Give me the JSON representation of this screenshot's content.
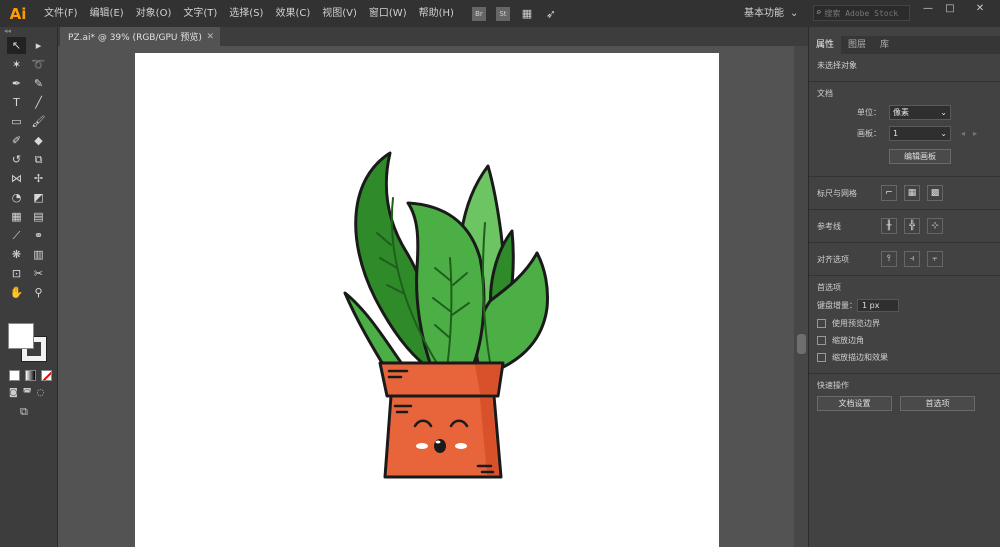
{
  "app": {
    "logo": "Ai",
    "accent": "#ff9a00"
  },
  "menu": [
    "文件(F)",
    "编辑(E)",
    "对象(O)",
    "文字(T)",
    "选择(S)",
    "效果(C)",
    "视图(V)",
    "窗口(W)",
    "帮助(H)"
  ],
  "menubar_icons": [
    "Br",
    "St",
    "arrange-icon",
    "send-icon"
  ],
  "workspace": {
    "label": "基本功能",
    "chevron": "⌄"
  },
  "search": {
    "placeholder": "搜索 Adobe Stock"
  },
  "window_controls": {
    "minimize": "—",
    "maximize": "□",
    "close": "✕"
  },
  "document_tab": {
    "title": "PZ.ai* @ 39% (RGB/GPU 预览)",
    "close": "✕"
  },
  "panel": {
    "tabs": [
      "属性",
      "图层",
      "库"
    ],
    "no_selection": "未选择对象",
    "document": {
      "title": "文档",
      "units_label": "单位：",
      "units_value": "像素",
      "artboard_label": "画板：",
      "artboard_value": "1",
      "edit_artboards": "编辑画板"
    },
    "rulers_grids": "标尺与网格",
    "guides": "参考线",
    "align_options": "对齐选项",
    "preferences": {
      "title": "首选项",
      "keyboard_increment_label": "键盘增量：",
      "keyboard_increment_value": "1 px",
      "use_preview_bounds": "使用预览边界",
      "scale_corners": "缩放边角",
      "scale_strokes_effects": "缩放描边和效果"
    },
    "quick_actions": {
      "title": "快速操作",
      "document_setup": "文档设置",
      "preferences": "首选项"
    }
  },
  "colors": {
    "pot": "#e8643a",
    "pot_shade": "#d9512b",
    "leaf_dark": "#2f8a2a",
    "leaf_mid": "#4caf45",
    "leaf_light": "#6cc562",
    "outline": "#1a1a1a"
  }
}
